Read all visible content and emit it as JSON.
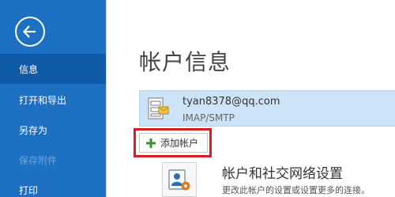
{
  "sidebar": {
    "back_label": "返回",
    "items": [
      {
        "label": "信息",
        "active": true,
        "disabled": false
      },
      {
        "label": "打开和导出",
        "active": false,
        "disabled": false
      },
      {
        "label": "另存为",
        "active": false,
        "disabled": false
      },
      {
        "label": "保存附件",
        "active": false,
        "disabled": true
      },
      {
        "label": "打印",
        "active": false,
        "disabled": false
      }
    ],
    "colors": {
      "background": "#1d70c2",
      "active": "#0f5ba8",
      "disabled_text": "#6fa4d8"
    }
  },
  "main": {
    "title": "帐户信息",
    "account": {
      "email": "tyan8378@qq.com",
      "type": "IMAP/SMTP",
      "icon": "mail-account-icon"
    },
    "add_account": {
      "label": "添加帐户",
      "icon": "plus-icon",
      "highlight_color": "#d81e1e"
    },
    "account_settings": {
      "title": "帐户和社交网络设置",
      "description": "更改此帐户的设置或设置更多的连接。",
      "icon": "account-settings-icon"
    }
  }
}
